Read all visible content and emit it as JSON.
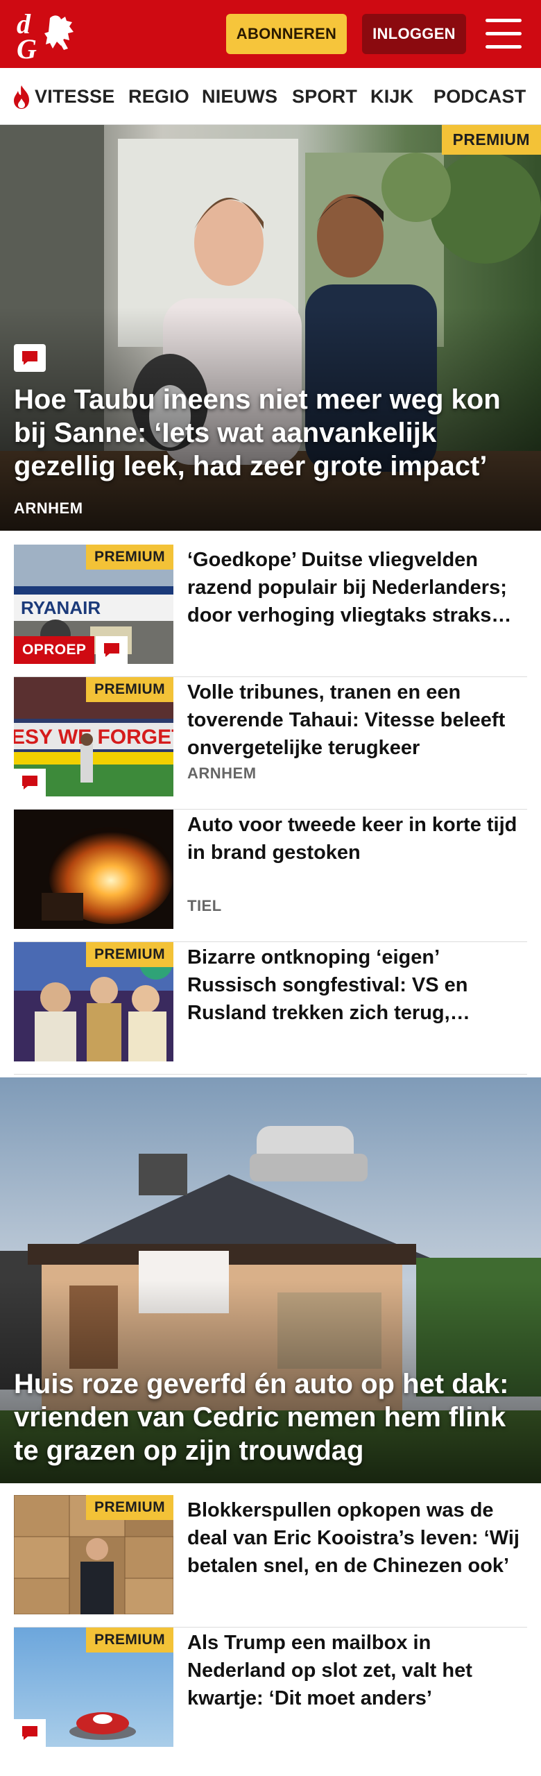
{
  "header": {
    "subscribe_label": "ABONNEREN",
    "login_label": "INLOGGEN",
    "colors": {
      "brand_red": "#cf0a12",
      "premium_yellow": "#f3c237",
      "login_dark": "#8b0a0f"
    }
  },
  "nav": {
    "items": [
      {
        "label": "VITESSE",
        "icon": "flame-icon"
      },
      {
        "label": "REGIO"
      },
      {
        "label": "NIEUWS"
      },
      {
        "label": "SPORT"
      },
      {
        "label": "KIJK"
      },
      {
        "label": "PODCAST"
      }
    ]
  },
  "hero": {
    "badge": "PREMIUM",
    "title": "Hoe Taubu ineens niet meer weg kon bij Sanne: ‘Iets wat aanvankelijk gezellig leek, had zeer grote impact’",
    "tag": "ARNHEM"
  },
  "articles": [
    {
      "badge": "PREMIUM",
      "label": "OPROEP",
      "title": "‘Goedkope’ Duitse vliegvelden razend populair bij Nederlanders; door verhoging vliegtaks straks nog drukker?"
    },
    {
      "badge": "PREMIUM",
      "title": "Volle tribunes, tranen en een toverende Tahaui: Vitesse beleeft onvergetelijke terugkeer",
      "tag": "ARNHEM"
    },
    {
      "title": "Auto voor tweede keer in korte tijd in brand gestoken",
      "tag": "TIEL"
    },
    {
      "badge": "PREMIUM",
      "title": "Bizarre ontknoping ‘eigen’ Russisch songfestival: VS en Rusland trekken zich terug, winnaar is..."
    }
  ],
  "hero2": {
    "title": "Huis roze geverfd én auto op het dak: vrienden van Cedric nemen hem flink te grazen op zijn trouwdag"
  },
  "articles2": [
    {
      "badge": "PREMIUM",
      "title": "Blokkerspullen opkopen was de deal van Eric Kooistra’s leven: ‘Wij betalen snel, en de Chinezen ook’"
    },
    {
      "badge": "PREMIUM",
      "title": "Als Trump een mailbox in Nederland op slot zet, valt het kwartje: ‘Dit moet anders’"
    }
  ]
}
